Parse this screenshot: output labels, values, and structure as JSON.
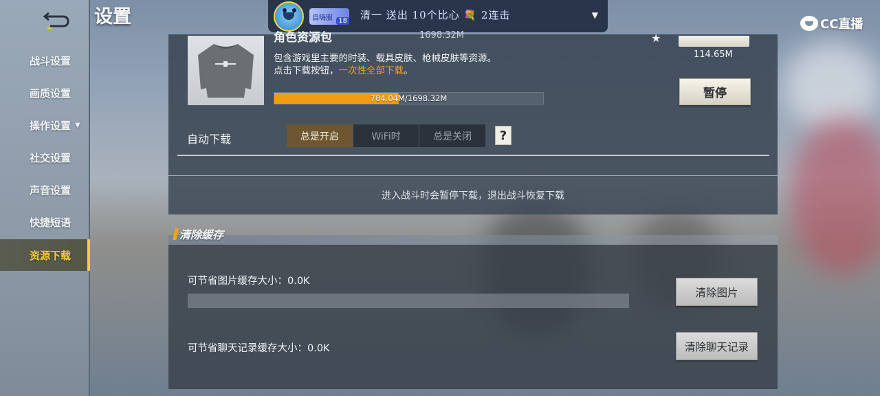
{
  "page_title": "设置",
  "sidebar": {
    "items": [
      {
        "label": "战斗设置"
      },
      {
        "label": "画质设置"
      },
      {
        "label": "操作设置",
        "has_arrow": true
      },
      {
        "label": "社交设置"
      },
      {
        "label": "声音设置"
      },
      {
        "label": "快捷短语"
      },
      {
        "label": "资源下载",
        "active": true
      }
    ]
  },
  "stream_notice": {
    "badge": "自嗨服",
    "level": "18",
    "message": "清一 送出 10个比心 💐 2连击"
  },
  "brand": "CC直播",
  "resource_package": {
    "title": "角色资源包",
    "total_size": "1698.32M",
    "description_line1": "包含游戏里主要的时装、载具皮肤、枪械皮肤等资源。",
    "description_line2_prefix": "点击下载按钮，",
    "description_line2_highlight": "一次性全部下载",
    "description_line2_suffix": "。",
    "progress_text": "784.04M/1698.32M",
    "progress_fraction": 0.4617,
    "extra_size": "114.65M",
    "pause_button": "暂停"
  },
  "auto_download": {
    "label": "自动下载",
    "options": [
      "总是开启",
      "WiFi时",
      "总是关闭"
    ],
    "selected": "总是开启",
    "help": "?"
  },
  "battle_notice": "进入战斗时会暂停下载，退出战斗恢复下载",
  "clear_cache": {
    "section_title": "清除缓存",
    "image_cache_label": "可节省图片缓存大小：0.0K",
    "image_button": "清除图片",
    "chat_cache_label": "可节省聊天记录缓存大小：0.0K",
    "chat_button": "清除聊天记录"
  },
  "colors": {
    "accent_orange": "#f39c12",
    "active_tab_yellow": "#f3d036"
  }
}
